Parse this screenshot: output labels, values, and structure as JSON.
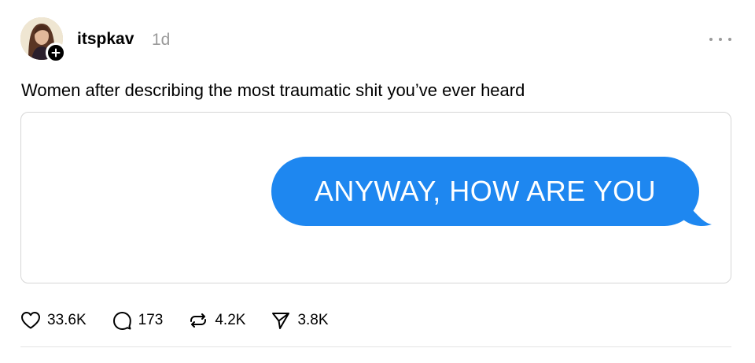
{
  "post": {
    "username": "itspkav",
    "timestamp": "1d",
    "text": "Women after describing the most traumatic shit you’ve ever heard",
    "media": {
      "message_text": "ANYWAY, HOW ARE YOU",
      "bubble_color": "#1e87f0"
    },
    "stats": {
      "likes": "33.6K",
      "replies": "173",
      "reposts": "4.2K",
      "shares": "3.8K"
    }
  },
  "icons": {
    "avatar": "avatar",
    "follow": "plus-icon",
    "more": "more-icon",
    "like": "heart-icon",
    "reply": "comment-icon",
    "repost": "repost-icon",
    "share": "send-icon"
  }
}
